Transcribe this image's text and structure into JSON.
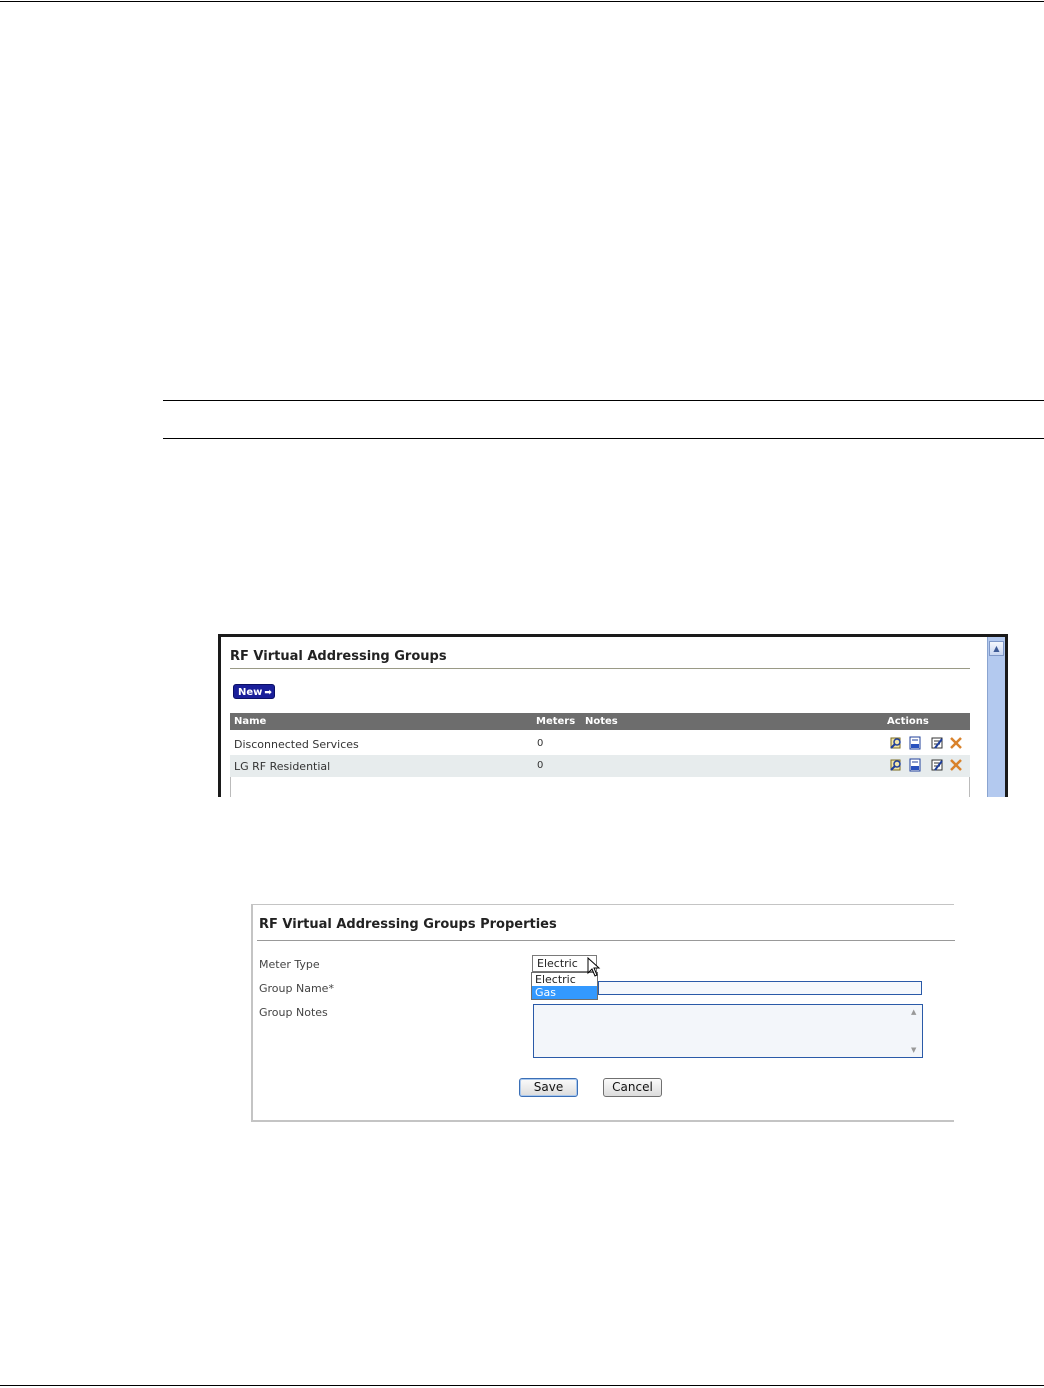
{
  "groups_panel": {
    "title": "RF Virtual Addressing Groups",
    "new_button": "New",
    "columns": {
      "name": "Name",
      "meters": "Meters",
      "notes": "Notes",
      "actions": "Actions"
    },
    "rows": [
      {
        "name": "Disconnected Services",
        "meters": "0",
        "notes": ""
      },
      {
        "name": "LG RF Residential",
        "meters": "0",
        "notes": ""
      }
    ],
    "action_icons": [
      "view-icon",
      "report-icon",
      "edit-icon",
      "delete-icon"
    ]
  },
  "properties_panel": {
    "title": "RF Virtual Addressing Groups Properties",
    "meter_type_label": "Meter Type",
    "meter_type_value": "Electric",
    "meter_type_options": [
      "Electric",
      "Gas"
    ],
    "highlighted_option": "Gas",
    "group_name_label": "Group Name*",
    "group_name_value": "",
    "group_notes_label": "Group Notes",
    "group_notes_value": "",
    "save_label": "Save",
    "cancel_label": "Cancel"
  },
  "colors": {
    "header_bg": "#6d6d6d",
    "alt_row_bg": "#e7eced",
    "new_button_bg": "#1a1f9a",
    "dropdown_highlight": "#3399ff",
    "scrollbar": "#b3c9ef"
  }
}
